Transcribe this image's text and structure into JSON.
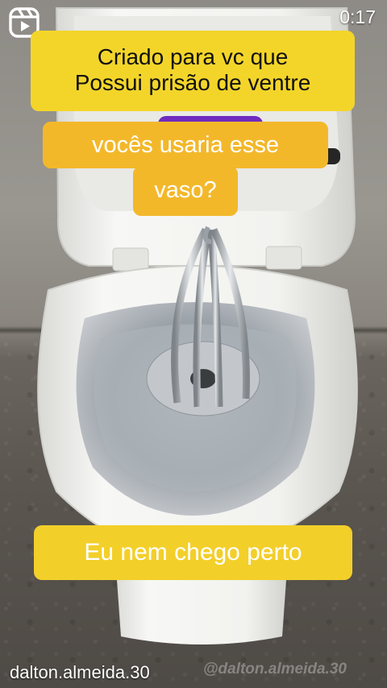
{
  "reels": {
    "icon": "reels-icon",
    "timer": "0:17"
  },
  "captions": {
    "top_line1": "Criado para vc que",
    "top_line2": "Possui prisão de ventre",
    "mid_line1": "vocês usaria esse",
    "mid_line2": "vaso?",
    "bottom": "Eu nem chego perto"
  },
  "footer": {
    "username": "dalton.almeida.30",
    "watermark": "@dalton.almeida.30"
  },
  "colors": {
    "caption_yellow": "#f3d52a",
    "caption_orange": "#f3b82a",
    "toilet_white": "#f2f2f0"
  }
}
